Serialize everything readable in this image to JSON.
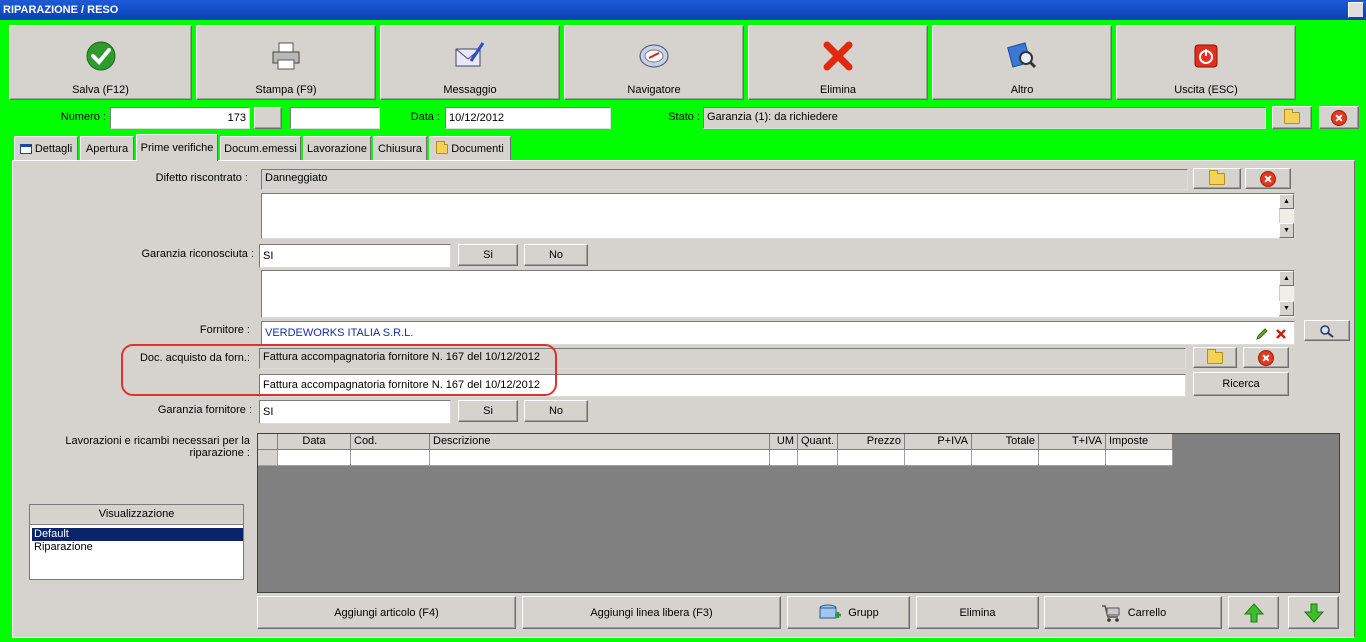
{
  "window": {
    "title": "RIPARAZIONE / RESO"
  },
  "toolbar": {
    "save": "Salva (F12)",
    "print": "Stampa (F9)",
    "message": "Messaggio",
    "navigator": "Navigatore",
    "delete": "Elimina",
    "other": "Altro",
    "exit": "Uscita (ESC)"
  },
  "header": {
    "numero_label": "Numero :",
    "numero_value": "173",
    "data_label": "Data :",
    "data_value": "10/12/2012",
    "stato_label": "Stato :",
    "stato_value": "Garanzia (1): da richiedere"
  },
  "tabs": [
    {
      "label": "Dettagli",
      "icon": "window-icon"
    },
    {
      "label": "Apertura"
    },
    {
      "label": "Prime verifiche",
      "active": true
    },
    {
      "label": "Docum.emessi"
    },
    {
      "label": "Lavorazione"
    },
    {
      "label": "Chiusura"
    },
    {
      "label": "Documenti",
      "icon": "folder-icon"
    }
  ],
  "form": {
    "difetto_label": "Difetto riscontrato :",
    "difetto_value": "Danneggiato",
    "garanzia_label": "Garanzia riconosciuta :",
    "garanzia_value": "SI",
    "si": "Si",
    "no": "No",
    "fornitore_label": "Fornitore :",
    "fornitore_value": "VERDEWORKS ITALIA S.R.L.",
    "doc_label": "Doc. acquisto da forn.:",
    "doc_value": "Fattura accompagnatoria fornitore N. 167 del 10/12/2012",
    "doc_value2": "Fattura accompagnatoria fornitore N. 167 del 10/12/2012",
    "ricerca": "Ricerca",
    "garanzia_forn_label": "Garanzia fornitore :",
    "garanzia_forn_value": "SI",
    "lavorazioni_label_1": "Lavorazioni e ricambi necessari per la",
    "lavorazioni_label_2": "riparazione :"
  },
  "grid": {
    "columns": [
      "",
      "Data",
      "Cod.",
      "Descrizione",
      "UM",
      "Quant.",
      "Prezzo",
      "P+IVA",
      "Totale",
      "T+IVA",
      "Imposte"
    ]
  },
  "visualizzazione": {
    "title": "Visualizzazione",
    "items": [
      "Default",
      "Riparazione"
    ]
  },
  "bottom": {
    "add_article": "Aggiungi articolo (F4)",
    "add_free_line": "Aggiungi linea libera (F3)",
    "group": "Grupp",
    "delete": "Elimina",
    "cart": "Carrello"
  },
  "colors": {
    "background": "#00ff00",
    "panel": "#d6d3ce",
    "title": "#0a3fb7",
    "highlight": "#e03030"
  }
}
